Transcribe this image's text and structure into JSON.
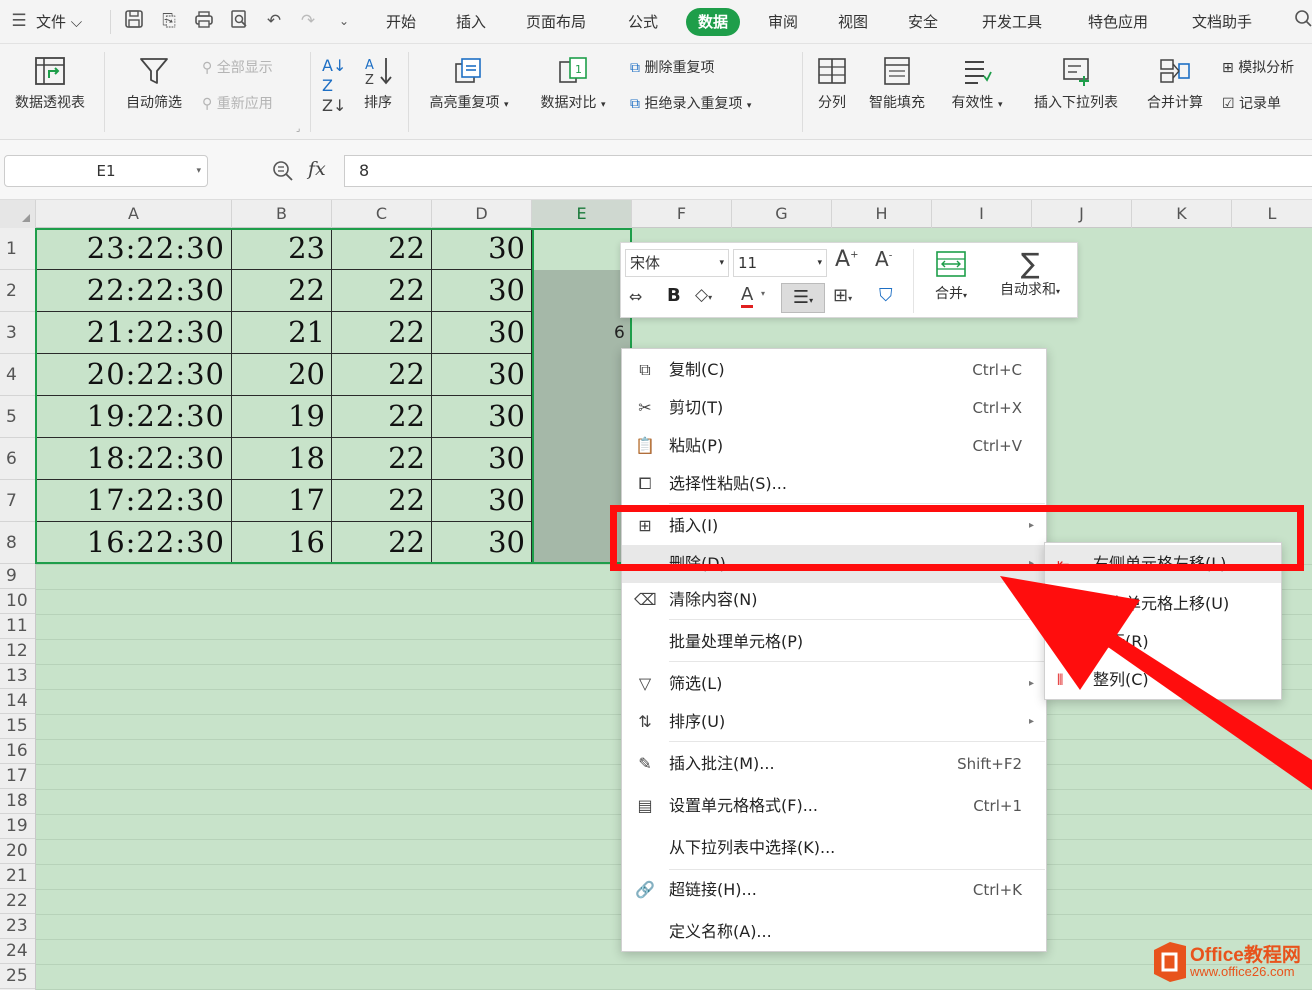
{
  "menubar": {
    "file_label": "文件",
    "tabs": [
      "开始",
      "插入",
      "页面布局",
      "公式",
      "数据",
      "审阅",
      "视图",
      "安全",
      "开发工具",
      "特色应用",
      "文档助手"
    ],
    "active_tab": "数据"
  },
  "ribbon": {
    "pivot": "数据透视表",
    "autofilter": "自动筛选",
    "show_all": "全部显示",
    "reapply": "重新应用",
    "sort": "排序",
    "highlight_dup": "高亮重复项",
    "compare": "数据对比",
    "delete_dup": "删除重复项",
    "reject_dup": "拒绝录入重复项",
    "split_col": "分列",
    "smart_fill": "智能填充",
    "validity": "有效性",
    "insert_dropdown": "插入下拉列表",
    "merge_calc": "合并计算",
    "simulate": "模拟分析",
    "record_sheet": "记录单"
  },
  "formula_bar": {
    "name_box": "E1",
    "fx": "fx",
    "value": "8"
  },
  "columns": [
    "A",
    "B",
    "C",
    "D",
    "E",
    "F",
    "G",
    "H",
    "I",
    "J",
    "K",
    "L"
  ],
  "rows": [
    "1",
    "2",
    "3",
    "4",
    "5",
    "6",
    "7",
    "8",
    "9",
    "10",
    "11",
    "12",
    "13",
    "14",
    "15",
    "16",
    "17",
    "18",
    "19",
    "20",
    "21",
    "22",
    "23",
    "24",
    "25"
  ],
  "table": [
    [
      "23:22:30",
      "23",
      "22",
      "30"
    ],
    [
      "22:22:30",
      "22",
      "22",
      "30"
    ],
    [
      "21:22:30",
      "21",
      "22",
      "30"
    ],
    [
      "20:22:30",
      "20",
      "22",
      "30"
    ],
    [
      "19:22:30",
      "19",
      "22",
      "30"
    ],
    [
      "18:22:30",
      "18",
      "22",
      "30"
    ],
    [
      "17:22:30",
      "17",
      "22",
      "30"
    ],
    [
      "16:22:30",
      "16",
      "22",
      "30"
    ]
  ],
  "peek_digit": "6",
  "mini_toolbar": {
    "font": "宋体",
    "size": "11",
    "bold": "B",
    "merge": "合并",
    "autosum": "自动求和"
  },
  "context_menu": [
    {
      "label": "复制(C)",
      "shortcut": "Ctrl+C",
      "icon": "copy-icon"
    },
    {
      "label": "剪切(T)",
      "shortcut": "Ctrl+X",
      "icon": "cut-icon"
    },
    {
      "label": "粘贴(P)",
      "shortcut": "Ctrl+V",
      "icon": "paste-icon"
    },
    {
      "label": "选择性粘贴(S)...",
      "shortcut": "",
      "icon": "paste-special-icon"
    },
    {
      "label": "插入(I)",
      "shortcut": "",
      "icon": "insert-icon"
    },
    {
      "label": "删除(D)",
      "shortcut": "",
      "icon": ""
    },
    {
      "label": "清除内容(N)",
      "shortcut": "",
      "icon": "eraser-icon"
    },
    {
      "label": "批量处理单元格(P)",
      "shortcut": "",
      "icon": ""
    },
    {
      "label": "筛选(L)",
      "shortcut": "",
      "icon": "filter-icon"
    },
    {
      "label": "排序(U)",
      "shortcut": "",
      "icon": "sort-icon"
    },
    {
      "label": "插入批注(M)...",
      "shortcut": "Shift+F2",
      "icon": "comment-icon"
    },
    {
      "label": "设置单元格格式(F)...",
      "shortcut": "Ctrl+1",
      "icon": "format-cells-icon"
    },
    {
      "label": "从下拉列表中选择(K)...",
      "shortcut": "",
      "icon": ""
    },
    {
      "label": "超链接(H)...",
      "shortcut": "Ctrl+K",
      "icon": "link-icon"
    },
    {
      "label": "定义名称(A)...",
      "shortcut": "",
      "icon": ""
    }
  ],
  "submenu": [
    {
      "label": "右侧单元格左移(L)"
    },
    {
      "label": "下方单元格上移(U)"
    },
    {
      "label": "整行(R)"
    },
    {
      "label": "整列(C)"
    }
  ],
  "watermark": {
    "brand": "Office教程网",
    "url": "www.office26.com"
  },
  "colors": {
    "accent_green": "#1e9e4a",
    "sheet_bg": "#c8e3ca",
    "annotation_red": "#ff0d0d"
  }
}
